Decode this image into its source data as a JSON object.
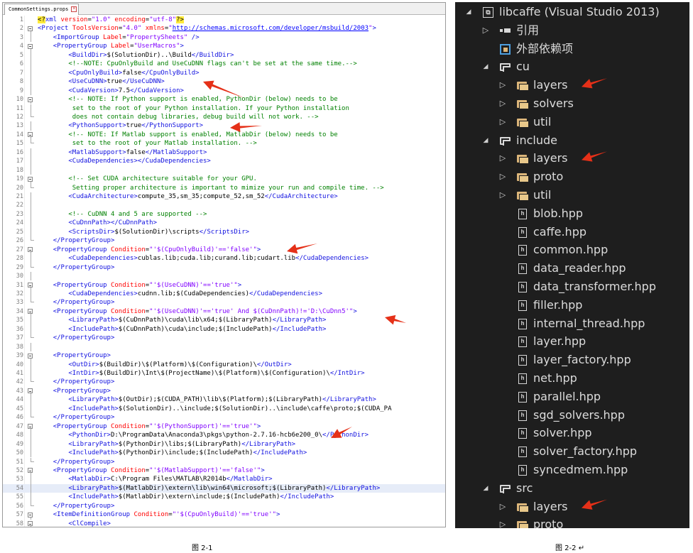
{
  "editor": {
    "tab_label": "CommonSettings.props",
    "tab_close": "×",
    "lines": [
      {
        "n": "1",
        "fold": "none",
        "html": "<span class=\"hl\">&lt;?</span><span class=\"c-tag\">xml</span> <span class=\"c-attr\">version</span>=<span class=\"c-str\">\"1.0\"</span> <span class=\"c-attr\">encoding</span>=<span class=\"c-str\">\"utf-8\"</span><span class=\"hl\">?&gt;</span>"
      },
      {
        "n": "2",
        "fold": "open",
        "html": "<span class=\"c-tag\">&lt;Project</span> <span class=\"c-attr\">ToolsVersion</span>=<span class=\"c-str\">\"4.0\"</span> <span class=\"c-attr\">xmlns</span>=<span class=\"c-str\">\"<span class=\"c-url\">http://schemas.microsoft.com/developer/msbuild/2003</span>\"</span><span class=\"c-tag\">&gt;</span>"
      },
      {
        "n": "3",
        "fold": "bar",
        "html": "    <span class=\"c-tag\">&lt;ImportGroup</span> <span class=\"c-attr\">Label</span>=<span class=\"c-str\">\"PropertySheets\"</span> <span class=\"c-tag\">/&gt;</span>"
      },
      {
        "n": "4",
        "fold": "open",
        "html": "    <span class=\"c-tag\">&lt;PropertyGroup</span> <span class=\"c-attr\">Label</span>=<span class=\"c-str\">\"UserMacros\"</span><span class=\"c-tag\">&gt;</span>"
      },
      {
        "n": "5",
        "fold": "bar",
        "html": "        <span class=\"c-tag\">&lt;BuildDir&gt;</span>$(SolutionDir)..\\Build<span class=\"c-tag\">&lt;/BuildDir&gt;</span>"
      },
      {
        "n": "6",
        "fold": "bar",
        "html": "        <span class=\"c-cm\">&lt;!--NOTE: CpuOnlyBuild and UseCuDNN flags can't be set at the same time.--&gt;</span>"
      },
      {
        "n": "7",
        "fold": "bar",
        "html": "        <span class=\"c-tag\">&lt;CpuOnlyBuild&gt;</span>false<span class=\"c-tag\">&lt;/CpuOnlyBuild&gt;</span>"
      },
      {
        "n": "8",
        "fold": "bar",
        "html": "        <span class=\"c-tag\">&lt;UseCuDNN&gt;</span>true<span class=\"c-tag\">&lt;/UseCuDNN&gt;</span>"
      },
      {
        "n": "9",
        "fold": "bar",
        "html": "        <span class=\"c-tag\">&lt;CudaVersion&gt;</span>7.5<span class=\"c-tag\">&lt;/CudaVersion&gt;</span>"
      },
      {
        "n": "10",
        "fold": "open",
        "html": "        <span class=\"c-cm\">&lt;!-- NOTE: If Python support is enabled, PythonDir (below) needs to be</span>"
      },
      {
        "n": "11",
        "fold": "bar",
        "html": "<span class=\"c-cm\">         set to the root of your Python installation. If your Python installation</span>"
      },
      {
        "n": "12",
        "fold": "end",
        "html": "<span class=\"c-cm\">         does not contain debug libraries, debug build will not work. --&gt;</span>"
      },
      {
        "n": "13",
        "fold": "bar",
        "html": "        <span class=\"c-tag\">&lt;PythonSupport&gt;</span>true<span class=\"c-tag\">&lt;/PythonSupport&gt;</span>"
      },
      {
        "n": "14",
        "fold": "open",
        "html": "        <span class=\"c-cm\">&lt;!-- NOTE: If Matlab support is enabled, MatlabDir (below) needs to be</span>"
      },
      {
        "n": "15",
        "fold": "end",
        "html": "<span class=\"c-cm\">         set to the root of your Matlab installation. --&gt;</span>"
      },
      {
        "n": "16",
        "fold": "bar",
        "html": "        <span class=\"c-tag\">&lt;MatlabSupport&gt;</span>false<span class=\"c-tag\">&lt;/MatlabSupport&gt;</span>"
      },
      {
        "n": "17",
        "fold": "bar",
        "html": "        <span class=\"c-tag\">&lt;CudaDependencies&gt;&lt;/CudaDependencies&gt;</span>"
      },
      {
        "n": "18",
        "fold": "bar",
        "html": ""
      },
      {
        "n": "19",
        "fold": "open",
        "html": "        <span class=\"c-cm\">&lt;!-- Set CUDA architecture suitable for your GPU.</span>"
      },
      {
        "n": "20",
        "fold": "end",
        "html": "<span class=\"c-cm\">         Setting proper architecture is important to mimize your run and compile time. --&gt;</span>"
      },
      {
        "n": "21",
        "fold": "bar",
        "html": "        <span class=\"c-tag\">&lt;CudaArchitecture&gt;</span>compute_35,sm_35;compute_52,sm_52<span class=\"c-tag\">&lt;/CudaArchitecture&gt;</span>"
      },
      {
        "n": "22",
        "fold": "bar",
        "html": ""
      },
      {
        "n": "23",
        "fold": "bar",
        "html": "        <span class=\"c-cm\">&lt;!-- CuDNN 4 and 5 are supported --&gt;</span>"
      },
      {
        "n": "24",
        "fold": "bar",
        "html": "        <span class=\"c-tag\">&lt;CuDnnPath&gt;&lt;/CuDnnPath&gt;</span>"
      },
      {
        "n": "25",
        "fold": "bar",
        "html": "        <span class=\"c-tag\">&lt;ScriptsDir&gt;</span>$(SolutionDir)\\scripts<span class=\"c-tag\">&lt;/ScriptsDir&gt;</span>"
      },
      {
        "n": "26",
        "fold": "end",
        "html": "    <span class=\"c-tag\">&lt;/PropertyGroup&gt;</span>"
      },
      {
        "n": "27",
        "fold": "open",
        "html": "    <span class=\"c-tag\">&lt;PropertyGroup</span> <span class=\"c-attr\">Condition</span>=<span class=\"c-str\">\"'$(CpuOnlyBuild)'=='false'\"</span><span class=\"c-tag\">&gt;</span>"
      },
      {
        "n": "28",
        "fold": "bar",
        "html": "        <span class=\"c-tag\">&lt;CudaDependencies&gt;</span>cublas.lib;cuda.lib;curand.lib;cudart.lib<span class=\"c-tag\">&lt;/CudaDependencies&gt;</span>"
      },
      {
        "n": "29",
        "fold": "end",
        "html": "    <span class=\"c-tag\">&lt;/PropertyGroup&gt;</span>"
      },
      {
        "n": "30",
        "fold": "bar",
        "html": ""
      },
      {
        "n": "31",
        "fold": "open",
        "html": "    <span class=\"c-tag\">&lt;PropertyGroup</span> <span class=\"c-attr\">Condition</span>=<span class=\"c-str\">\"'$(UseCuDNN)'=='true'\"</span><span class=\"c-tag\">&gt;</span>"
      },
      {
        "n": "32",
        "fold": "bar",
        "html": "        <span class=\"c-tag\">&lt;CudaDependencies&gt;</span>cudnn.lib;$(CudaDependencies)<span class=\"c-tag\">&lt;/CudaDependencies&gt;</span>"
      },
      {
        "n": "33",
        "fold": "end",
        "html": "    <span class=\"c-tag\">&lt;/PropertyGroup&gt;</span>"
      },
      {
        "n": "34",
        "fold": "open",
        "html": "    <span class=\"c-tag\">&lt;PropertyGroup</span> <span class=\"c-attr\">Condition</span>=<span class=\"c-str\">\"'$(UseCuDNN)'=='true' And $(CuDnnPath)!='D:\\CuDnn5'\"</span><span class=\"c-tag\">&gt;</span>"
      },
      {
        "n": "35",
        "fold": "bar",
        "html": "        <span class=\"c-tag\">&lt;LibraryPath&gt;</span>$(CuDnnPath)\\cuda\\lib\\x64;$(LibraryPath)<span class=\"c-tag\">&lt;/LibraryPath&gt;</span>"
      },
      {
        "n": "36",
        "fold": "bar",
        "html": "        <span class=\"c-tag\">&lt;IncludePath&gt;</span>$(CuDnnPath)\\cuda\\include;$(IncludePath)<span class=\"c-tag\">&lt;/IncludePath&gt;</span>"
      },
      {
        "n": "37",
        "fold": "end",
        "html": "    <span class=\"c-tag\">&lt;/PropertyGroup&gt;</span>"
      },
      {
        "n": "38",
        "fold": "bar",
        "html": ""
      },
      {
        "n": "39",
        "fold": "open",
        "html": "    <span class=\"c-tag\">&lt;PropertyGroup&gt;</span>"
      },
      {
        "n": "40",
        "fold": "bar",
        "html": "        <span class=\"c-tag\">&lt;OutDir&gt;</span>$(BuildDir)\\$(Platform)\\$(Configuration)\\<span class=\"c-tag\">&lt;/OutDir&gt;</span>"
      },
      {
        "n": "41",
        "fold": "bar",
        "html": "        <span class=\"c-tag\">&lt;IntDir&gt;</span>$(BuildDir)\\Int\\$(ProjectName)\\$(Platform)\\$(Configuration)\\<span class=\"c-tag\">&lt;/IntDir&gt;</span>"
      },
      {
        "n": "42",
        "fold": "end",
        "html": "    <span class=\"c-tag\">&lt;/PropertyGroup&gt;</span>"
      },
      {
        "n": "43",
        "fold": "open",
        "html": "    <span class=\"c-tag\">&lt;PropertyGroup&gt;</span>"
      },
      {
        "n": "44",
        "fold": "bar",
        "html": "        <span class=\"c-tag\">&lt;LibraryPath&gt;</span>$(OutDir);$(CUDA_PATH)\\lib\\$(Platform);$(LibraryPath)<span class=\"c-tag\">&lt;/LibraryPath&gt;</span>"
      },
      {
        "n": "45",
        "fold": "bar",
        "html": "        <span class=\"c-tag\">&lt;IncludePath&gt;</span>$(SolutionDir)..\\include;$(SolutionDir)..\\include\\caffe\\proto;$(CUDA_PA"
      },
      {
        "n": "46",
        "fold": "end",
        "html": "    <span class=\"c-tag\">&lt;/PropertyGroup&gt;</span>"
      },
      {
        "n": "47",
        "fold": "open",
        "html": "    <span class=\"c-tag\">&lt;PropertyGroup</span> <span class=\"c-attr\">Condition</span>=<span class=\"c-str\">\"'$(PythonSupport)'=='true'\"</span><span class=\"c-tag\">&gt;</span>"
      },
      {
        "n": "48",
        "fold": "bar",
        "html": "        <span class=\"c-tag\">&lt;PythonDir&gt;</span>D:\\ProgramData\\Anaconda3\\pkgs\\python-2.7.16-hcb6e200_0\\<span class=\"c-tag\">&lt;/PythonDir&gt;</span>"
      },
      {
        "n": "49",
        "fold": "bar",
        "html": "        <span class=\"c-tag\">&lt;LibraryPath&gt;</span>$(PythonDir)\\libs;$(LibraryPath)<span class=\"c-tag\">&lt;/LibraryPath&gt;</span>"
      },
      {
        "n": "50",
        "fold": "bar",
        "html": "        <span class=\"c-tag\">&lt;IncludePath&gt;</span>$(PythonDir)\\include;$(IncludePath)<span class=\"c-tag\">&lt;/IncludePath&gt;</span>"
      },
      {
        "n": "51",
        "fold": "end",
        "html": "    <span class=\"c-tag\">&lt;/PropertyGroup&gt;</span>"
      },
      {
        "n": "52",
        "fold": "open",
        "html": "    <span class=\"c-tag\">&lt;PropertyGroup</span> <span class=\"c-attr\">Condition</span>=<span class=\"c-str\">\"'$(MatlabSupport)'=='false'\"</span><span class=\"c-tag\">&gt;</span>"
      },
      {
        "n": "53",
        "fold": "bar",
        "html": "        <span class=\"c-tag\">&lt;MatlabDir&gt;</span>C:\\Program Files\\MATLAB\\R2014b<span class=\"c-tag\">&lt;/MatlabDir&gt;</span>"
      },
      {
        "n": "54",
        "fold": "bar",
        "sel": true,
        "html": "        <span class=\"c-tag\">&lt;LibraryPath&gt;</span>$(MatlabDir)\\extern\\lib\\win64\\microsoft;$(LibraryPath)<span class=\"c-tag\">&lt;/LibraryPath&gt;</span>"
      },
      {
        "n": "55",
        "fold": "bar",
        "html": "        <span class=\"c-tag\">&lt;IncludePath&gt;</span>$(MatlabDir)\\extern\\include;$(IncludePath)<span class=\"c-tag\">&lt;/IncludePath&gt;</span>"
      },
      {
        "n": "56",
        "fold": "end",
        "html": "    <span class=\"c-tag\">&lt;/PropertyGroup&gt;</span>"
      },
      {
        "n": "57",
        "fold": "open",
        "html": "    <span class=\"c-tag\">&lt;ItemDefinitionGroup</span> <span class=\"c-attr\">Condition</span>=<span class=\"c-str\">\"'$(CpuOnlyBuild)'=='true'\"</span><span class=\"c-tag\">&gt;</span>"
      },
      {
        "n": "58",
        "fold": "open",
        "html": "        <span class=\"c-tag\">&lt;ClCompile&gt;</span>"
      }
    ],
    "arrow_color": "#e53018"
  },
  "caption_left": "图 2-1",
  "caption_right": "图 2-2 ↵",
  "solution": {
    "arrow_color": "#e53018",
    "rows": [
      {
        "label": "libcaffe (Visual Studio 2013)",
        "level": 0,
        "expander": "open",
        "icon": "vs-project-icon"
      },
      {
        "label": "引用",
        "level": 1,
        "expander": "closed",
        "icon": "references-icon"
      },
      {
        "label": "外部依赖项",
        "level": 1,
        "expander": "none",
        "icon": "external-deps-icon"
      },
      {
        "label": "cu",
        "level": 1,
        "expander": "open",
        "icon": "filter-folder-icon"
      },
      {
        "label": "layers",
        "level": 2,
        "expander": "closed",
        "icon": "folder-icon",
        "arrow": true
      },
      {
        "label": "solvers",
        "level": 2,
        "expander": "closed",
        "icon": "folder-icon"
      },
      {
        "label": "util",
        "level": 2,
        "expander": "closed",
        "icon": "folder-icon"
      },
      {
        "label": "include",
        "level": 1,
        "expander": "open",
        "icon": "filter-folder-icon"
      },
      {
        "label": "layers",
        "level": 2,
        "expander": "closed",
        "icon": "folder-icon",
        "arrow": true
      },
      {
        "label": "proto",
        "level": 2,
        "expander": "closed",
        "icon": "folder-icon"
      },
      {
        "label": "util",
        "level": 2,
        "expander": "closed",
        "icon": "folder-icon"
      },
      {
        "label": "blob.hpp",
        "level": 2,
        "expander": "none",
        "icon": "header-file-icon"
      },
      {
        "label": "caffe.hpp",
        "level": 2,
        "expander": "none",
        "icon": "header-file-icon"
      },
      {
        "label": "common.hpp",
        "level": 2,
        "expander": "none",
        "icon": "header-file-icon"
      },
      {
        "label": "data_reader.hpp",
        "level": 2,
        "expander": "none",
        "icon": "header-file-icon"
      },
      {
        "label": "data_transformer.hpp",
        "level": 2,
        "expander": "none",
        "icon": "header-file-icon"
      },
      {
        "label": "filler.hpp",
        "level": 2,
        "expander": "none",
        "icon": "header-file-icon"
      },
      {
        "label": "internal_thread.hpp",
        "level": 2,
        "expander": "none",
        "icon": "header-file-icon"
      },
      {
        "label": "layer.hpp",
        "level": 2,
        "expander": "none",
        "icon": "header-file-icon"
      },
      {
        "label": "layer_factory.hpp",
        "level": 2,
        "expander": "none",
        "icon": "header-file-icon"
      },
      {
        "label": "net.hpp",
        "level": 2,
        "expander": "none",
        "icon": "header-file-icon"
      },
      {
        "label": "parallel.hpp",
        "level": 2,
        "expander": "none",
        "icon": "header-file-icon"
      },
      {
        "label": "sgd_solvers.hpp",
        "level": 2,
        "expander": "none",
        "icon": "header-file-icon"
      },
      {
        "label": "solver.hpp",
        "level": 2,
        "expander": "none",
        "icon": "header-file-icon"
      },
      {
        "label": "solver_factory.hpp",
        "level": 2,
        "expander": "none",
        "icon": "header-file-icon"
      },
      {
        "label": "syncedmem.hpp",
        "level": 2,
        "expander": "none",
        "icon": "header-file-icon"
      },
      {
        "label": "src",
        "level": 1,
        "expander": "open",
        "icon": "filter-folder-icon"
      },
      {
        "label": "layers",
        "level": 2,
        "expander": "closed",
        "icon": "folder-icon",
        "arrow": true
      },
      {
        "label": "proto",
        "level": 2,
        "expander": "closed",
        "icon": "folder-icon"
      }
    ]
  }
}
